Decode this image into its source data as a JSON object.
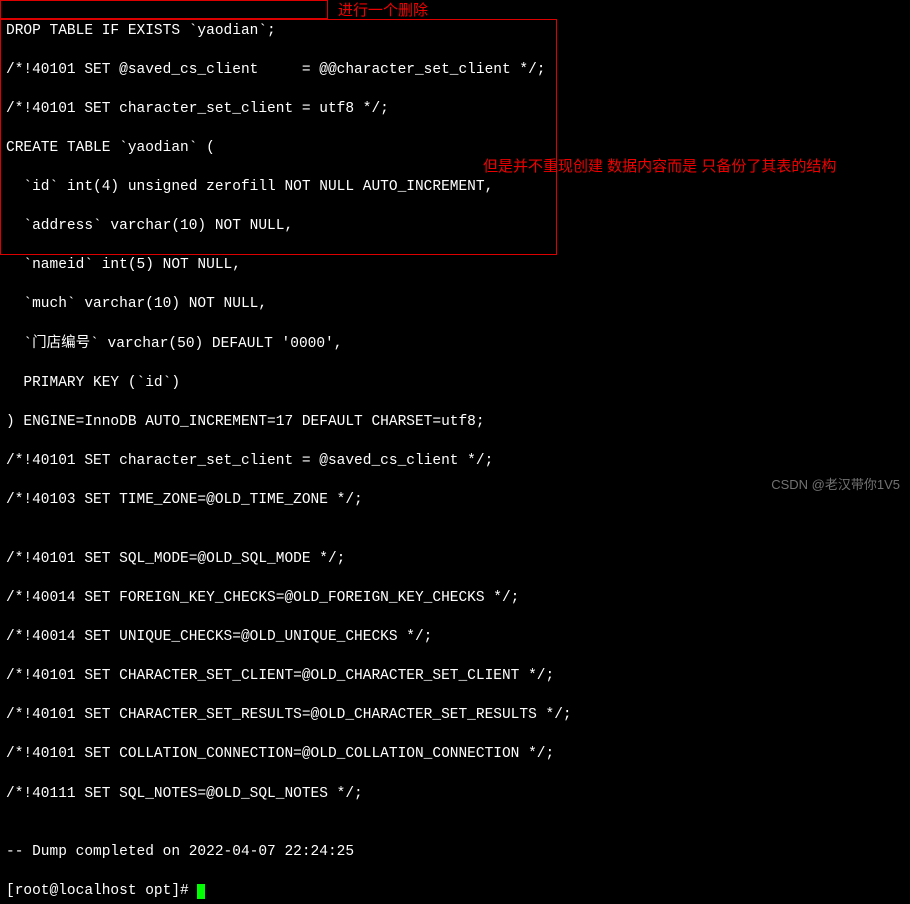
{
  "annotations": {
    "label1": "进行一个删除",
    "label2": "但是并不重现创建 数据内容而是 只备份了其表的结构"
  },
  "sql": {
    "drop_line": "DROP TABLE IF EXISTS `yaodian`;",
    "set1": "/*!40101 SET @saved_cs_client     = @@character_set_client */;",
    "set2": "/*!40101 SET character_set_client = utf8 */;",
    "create_open": "CREATE TABLE `yaodian` (",
    "col_id": "  `id` int(4) unsigned zerofill NOT NULL AUTO_INCREMENT,",
    "col_address": "  `address` varchar(10) NOT NULL,",
    "col_nameid": "  `nameid` int(5) NOT NULL,",
    "col_much": "  `much` varchar(10) NOT NULL,",
    "col_store": "  `门店编号` varchar(50) DEFAULT '0000',",
    "pk": "  PRIMARY KEY (`id`)",
    "create_close": ") ENGINE=InnoDB AUTO_INCREMENT=17 DEFAULT CHARSET=utf8;",
    "set3": "/*!40101 SET character_set_client = @saved_cs_client */;",
    "set4": "/*!40103 SET TIME_ZONE=@OLD_TIME_ZONE */;",
    "blank1": "",
    "set5": "/*!40101 SET SQL_MODE=@OLD_SQL_MODE */;",
    "set6": "/*!40014 SET FOREIGN_KEY_CHECKS=@OLD_FOREIGN_KEY_CHECKS */;",
    "set7": "/*!40014 SET UNIQUE_CHECKS=@OLD_UNIQUE_CHECKS */;",
    "set8": "/*!40101 SET CHARACTER_SET_CLIENT=@OLD_CHARACTER_SET_CLIENT */;",
    "set9": "/*!40101 SET CHARACTER_SET_RESULTS=@OLD_CHARACTER_SET_RESULTS */;",
    "set10": "/*!40101 SET COLLATION_CONNECTION=@OLD_COLLATION_CONNECTION */;",
    "set11": "/*!40111 SET SQL_NOTES=@OLD_SQL_NOTES */;",
    "blank2": "",
    "dump_done": "-- Dump completed on 2022-04-07 22:24:25",
    "prompt": "[root@localhost opt]# "
  },
  "watermark": "CSDN @老汉带你1V5"
}
